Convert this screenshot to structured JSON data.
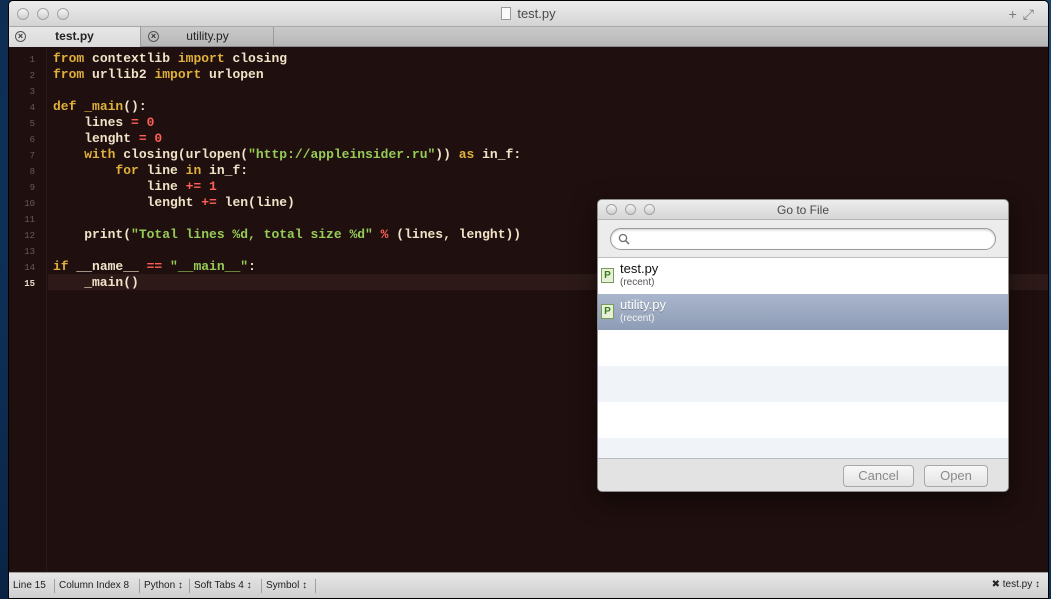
{
  "window": {
    "title": "test.py"
  },
  "tabs": [
    {
      "label": "test.py",
      "active": true
    },
    {
      "label": "utility.py",
      "active": false
    }
  ],
  "editor": {
    "current_line": 15,
    "line_numbers": [
      "1",
      "2",
      "3",
      "4",
      "5",
      "6",
      "7",
      "8",
      "9",
      "10",
      "11",
      "12",
      "13",
      "14",
      "15"
    ],
    "lines": [
      "from contextlib import closing",
      "from urllib2 import urlopen",
      "",
      "def _main():",
      "    lines = 0",
      "    lenght = 0",
      "    with closing(urlopen(\"http://appleinsider.ru\")) as in_f:",
      "        for line in in_f:",
      "            line += 1",
      "            lenght += len(line)",
      "",
      "    print(\"Total lines %d, total size %d\" % (lines, lenght))",
      "",
      "if __name__ == \"__main__\":",
      "    _main()"
    ]
  },
  "status": {
    "line": "Line 15",
    "column": "Column Index 8",
    "syntax": "Python ↕",
    "tabs": "Soft Tabs 4 ↕",
    "symbol": "Symbol ↕",
    "file": "test.py ↕"
  },
  "dialog": {
    "title": "Go to File",
    "search_placeholder": "",
    "files": [
      {
        "name": "test.py",
        "sub": "(recent)",
        "selected": false
      },
      {
        "name": "utility.py",
        "sub": "(recent)",
        "selected": true
      }
    ],
    "cancel_label": "Cancel",
    "open_label": "Open"
  },
  "colors": {
    "editor_bg": "#1f0f0e",
    "keyword": "#dfb03c",
    "number": "#ff5f57",
    "string": "#96cc56",
    "selection": "#8e9cb6"
  }
}
